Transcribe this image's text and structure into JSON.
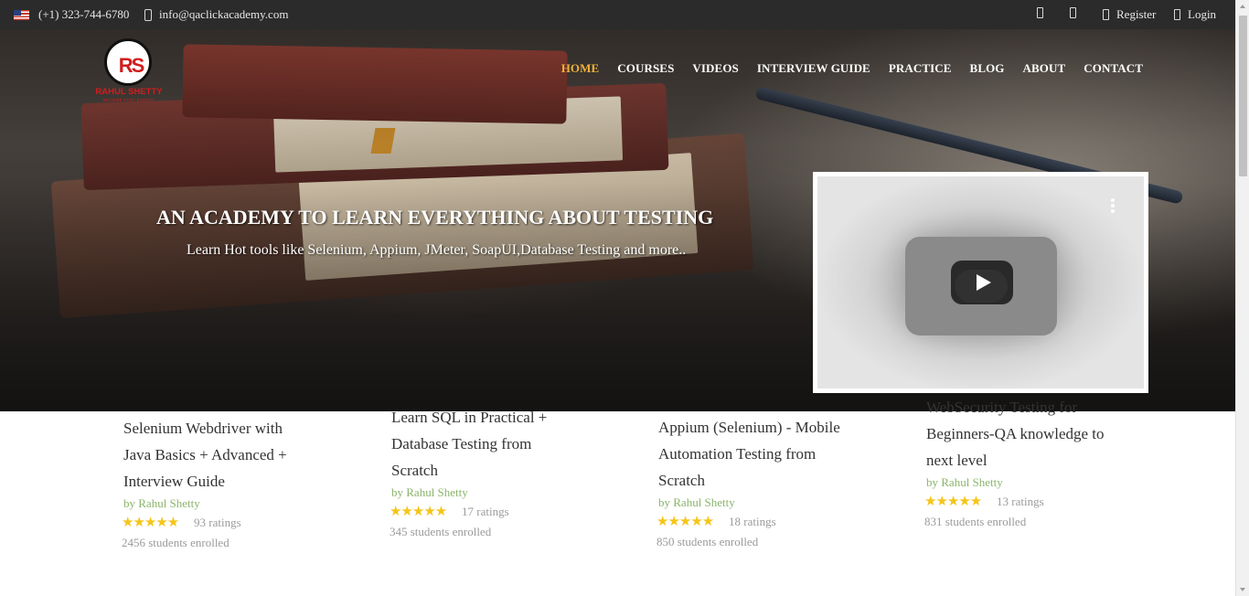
{
  "topbar": {
    "phone": "(+1) 323-744-6780",
    "email": "info@qaclickacademy.com",
    "register": "Register",
    "login": "Login"
  },
  "logo": {
    "mark": "RS",
    "name": "RAHUL SHETTY",
    "tagline": "BECOME TEST EXPERT"
  },
  "nav": {
    "items": [
      "HOME",
      "COURSES",
      "VIDEOS",
      "INTERVIEW GUIDE",
      "PRACTICE",
      "BLOG",
      "ABOUT",
      "CONTACT"
    ],
    "active": "HOME",
    "active_color": "#f0b23a"
  },
  "hero": {
    "title": "AN ACADEMY TO LEARN EVERYTHING ABOUT TESTING",
    "subtitle": "Learn Hot tools like Selenium, Appium, JMeter, SoapUI,Database Testing and more.."
  },
  "courses": [
    {
      "title_lines": [
        "Selenium Webdriver with",
        "Java Basics + Advanced +",
        "Interview Guide"
      ],
      "author": "by Rahul Shetty",
      "stars": "★★★★★",
      "ratings": "93 ratings",
      "students": "2456 students enrolled"
    },
    {
      "title_lines": [
        "Learn SQL in Practical +",
        "Database Testing from",
        "Scratch"
      ],
      "author": "by Rahul Shetty",
      "stars": "★★★★★",
      "ratings": "17 ratings",
      "students": "345 students enrolled"
    },
    {
      "title_lines": [
        "Appium (Selenium) - Mobile",
        "Automation Testing from",
        "Scratch"
      ],
      "author": "by Rahul Shetty",
      "stars": "★★★★★",
      "ratings": "18 ratings",
      "students": "850 students enrolled"
    },
    {
      "title_lines": [
        "WebSecurity Testing for",
        "Beginners-QA knowledge to",
        "next level"
      ],
      "author": "by Rahul Shetty",
      "stars": "★★★★★",
      "ratings": "13 ratings",
      "students": "831 students enrolled"
    }
  ],
  "colors": {
    "accent": "#f0b23a",
    "brand_red": "#d11d1d",
    "author_green": "#8ab56b",
    "star_yellow": "#f5c518"
  }
}
